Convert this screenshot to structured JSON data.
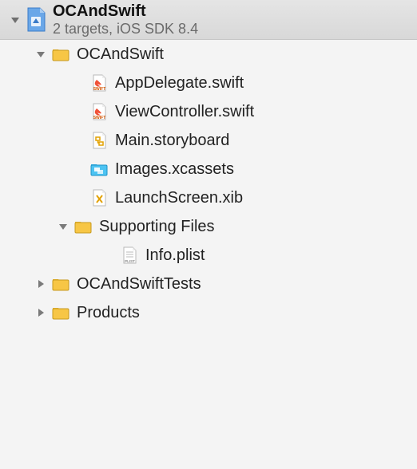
{
  "project": {
    "name": "OCAndSwift",
    "subtitle": "2 targets, iOS SDK 8.4"
  },
  "groups": {
    "main": {
      "name": "OCAndSwift"
    },
    "supporting": {
      "name": "Supporting Files"
    },
    "tests": {
      "name": "OCAndSwiftTests"
    },
    "products": {
      "name": "Products"
    }
  },
  "files": {
    "appDelegate": "AppDelegate.swift",
    "viewController": "ViewController.swift",
    "mainStoryboard": "Main.storyboard",
    "images": "Images.xcassets",
    "launchScreen": "LaunchScreen.xib",
    "infoPlist": "Info.plist"
  }
}
